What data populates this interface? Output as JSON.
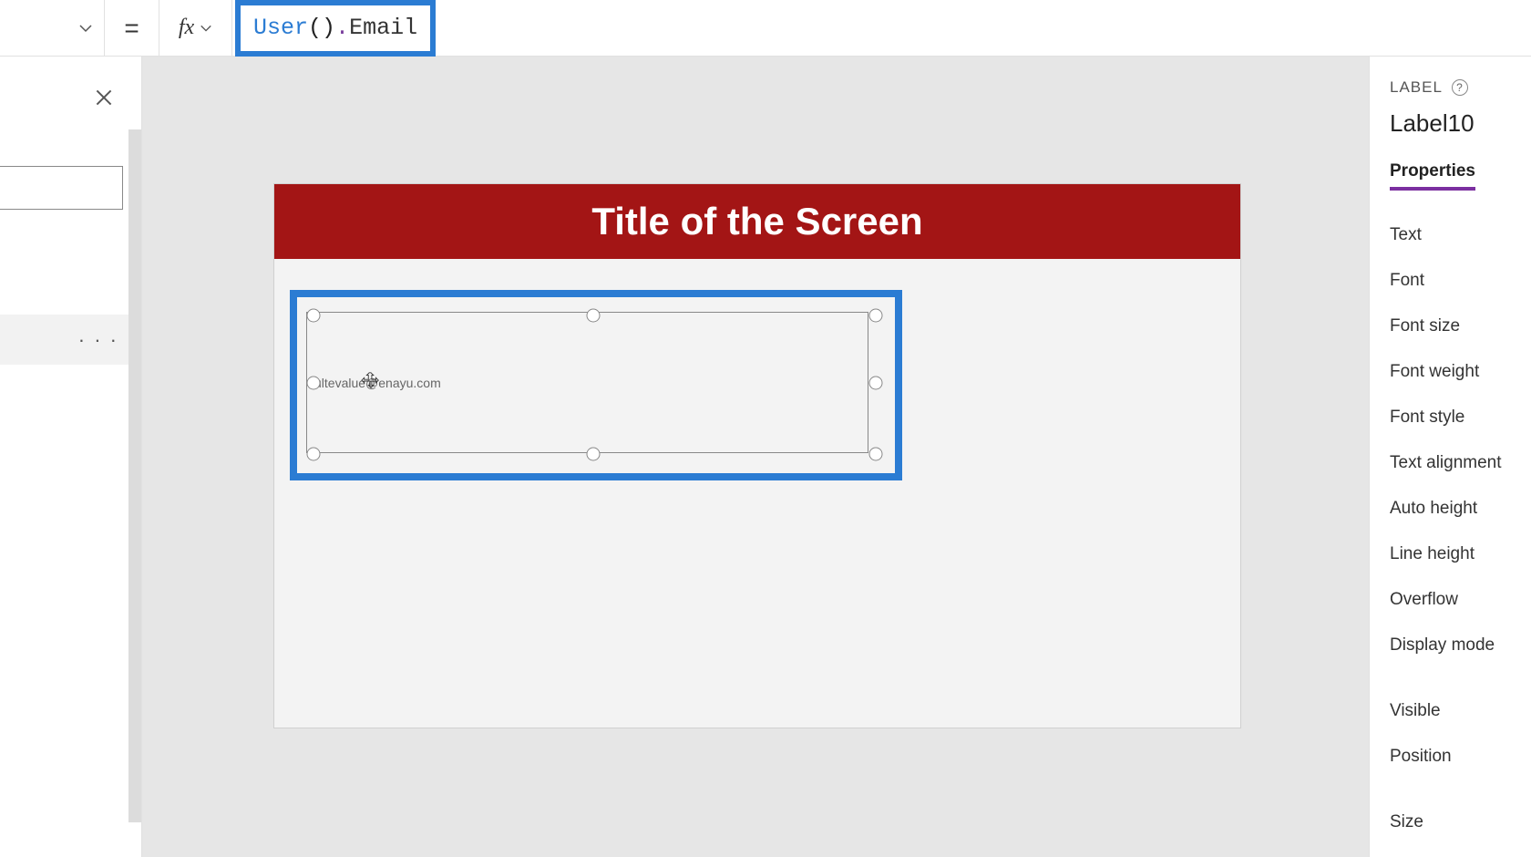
{
  "formula_bar": {
    "equals": "=",
    "fx_label": "fx",
    "tokens": {
      "func": "User",
      "open": "(",
      "close": ")",
      "dot": ".",
      "prop": "Email"
    }
  },
  "left_panel": {
    "ellipsis": "· · ·"
  },
  "canvas": {
    "title": "Title of the Screen",
    "label_value": "ultevalue@enayu.com"
  },
  "right_panel": {
    "header": "LABEL",
    "help": "?",
    "control_name": "Label10",
    "tab": "Properties",
    "properties": [
      "Text",
      "Font",
      "Font size",
      "Font weight",
      "Font style",
      "Text alignment",
      "Auto height",
      "Line height",
      "Overflow",
      "Display mode"
    ],
    "properties2": [
      "Visible",
      "Position"
    ],
    "properties3": [
      "Size"
    ]
  }
}
